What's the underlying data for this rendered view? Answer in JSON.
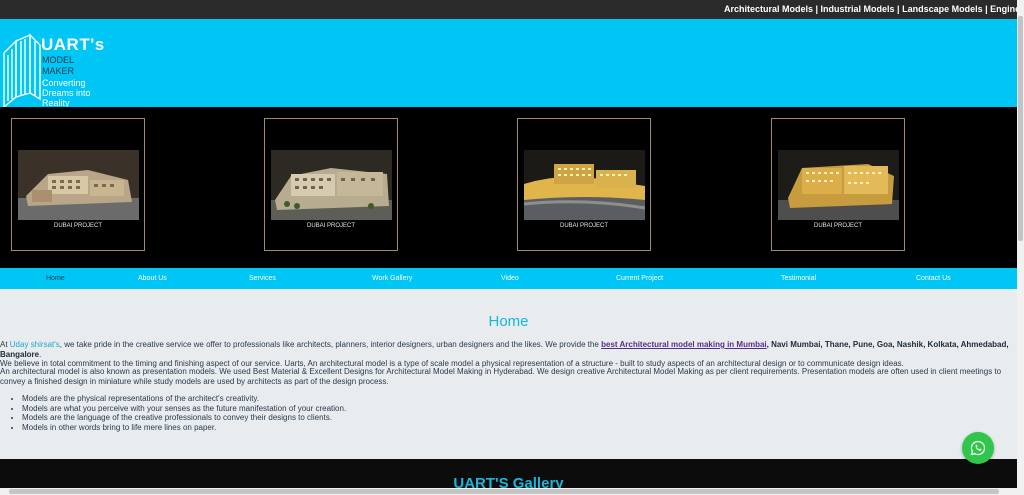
{
  "ticker": {
    "text": "Architectural Models | Industrial Models | Landscape Models | Engineering Mo"
  },
  "logo": {
    "title": "UART's",
    "sub_line1": "MODEL",
    "sub_line2": "MAKER",
    "tagline": "Converting Dreams into Reality",
    "icon": "building-logo-icon"
  },
  "projects": [
    {
      "caption": "DUBAI PROJECT"
    },
    {
      "caption": "DUBAI PROJECT"
    },
    {
      "caption": "DUBAI PROJECT"
    },
    {
      "caption": "DUBAI PROJECT"
    }
  ],
  "nav": {
    "items": [
      {
        "label": "Home"
      },
      {
        "label": "About Us"
      },
      {
        "label": "Services"
      },
      {
        "label": "Work Gallery"
      },
      {
        "label": "Video"
      },
      {
        "label": "Current Project"
      },
      {
        "label": "Testimonial"
      },
      {
        "label": "Contact Us"
      }
    ]
  },
  "home": {
    "heading": "Home",
    "p1_prefix": "At ",
    "p1_name": "Uday shirsat's",
    "p1_text": ", we take pride in the creative service we offer to professionals like architects, planners, interior designers, urban designers and the likes. We provide the ",
    "p1_link": "best Architectural model making in Mumbai",
    "p1_cities": ", Navi Mumbai, Thane, Pune, Goa, Nashik, Kolkata, Ahmedabad, Bangalore",
    "p1_end": ".",
    "p1_line2": "We believe in total commitment to the timing and finishing aspect of our service. Uarts, An architectural model is a type of scale model a physical representation of a structure - built to study aspects of an architectural design or to communicate design ideas.",
    "p2": "An architectural model is also known as presentation models. We used Best Material & Excellent Designs for Architectural Model Making in Hyderabad. We design creative Architectural Model Making as per client requirements. Presentation models are often used in client meetings to convey a finished design in miniature while study models are used by architects as part of the design process.",
    "bullets": [
      "Models are the physical representations of the architect's creativity.",
      "Models are what you perceive with your senses as the future manifestation of your creation.",
      "Models are the language of the creative professionals to convey their designs to clients.",
      "Models in other words bring to life mere lines on paper."
    ]
  },
  "gallery": {
    "title": "UART'S Gallery"
  },
  "colors": {
    "accent": "#00c6f5",
    "heading": "#19b6dc",
    "whatsapp": "#2fc64b"
  },
  "whatsapp": {
    "icon": "whatsapp-icon"
  }
}
